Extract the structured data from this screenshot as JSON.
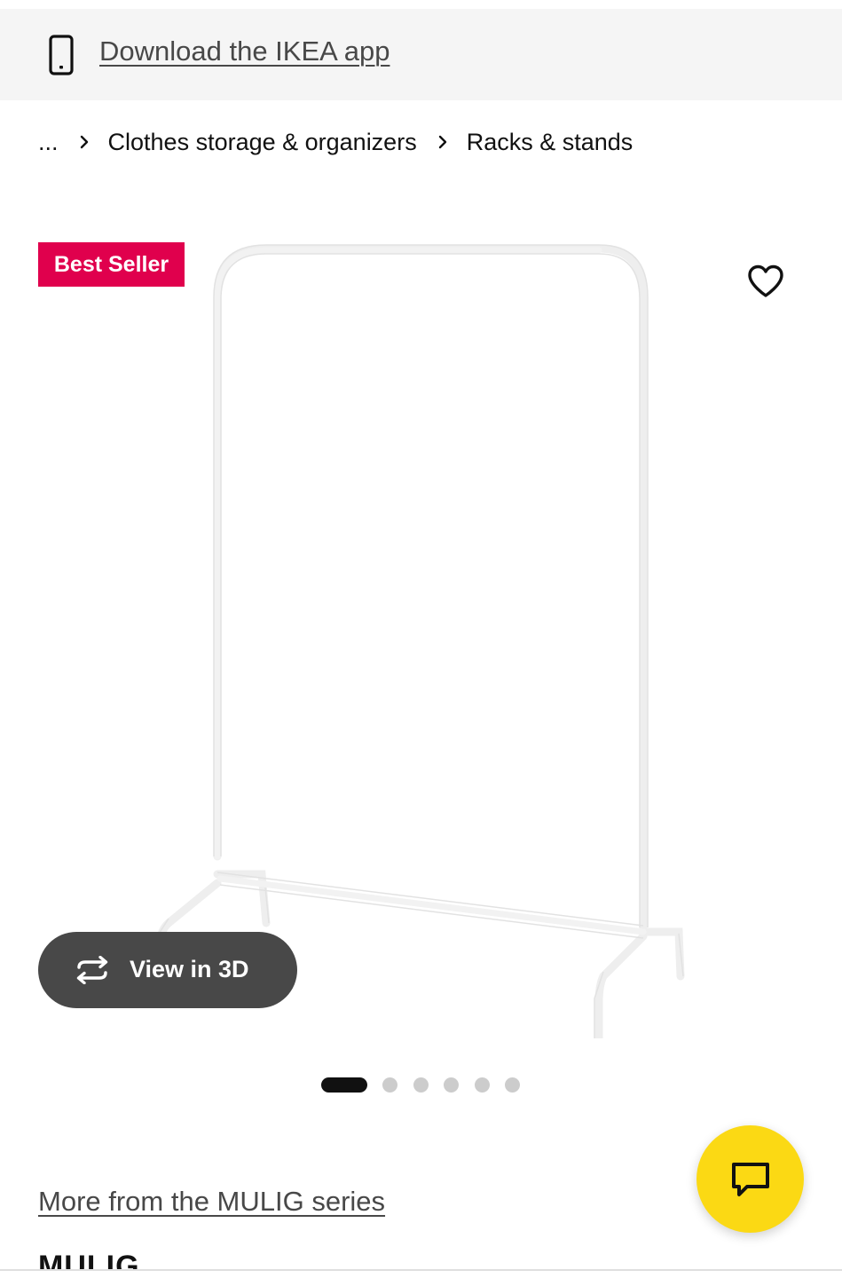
{
  "banner": {
    "text": "Download the IKEA app",
    "icon": "phone-icon"
  },
  "breadcrumb": {
    "items": [
      {
        "label": "..."
      },
      {
        "label": "Clothes storage & organizers"
      },
      {
        "label": "Racks & stands"
      }
    ]
  },
  "product": {
    "badge": "Best Seller",
    "badge_color": "#e0004d",
    "name": "MULIG",
    "image_icon": "clothes-rack-image",
    "favorite_icon": "heart-outline-icon"
  },
  "gallery": {
    "view3d_label": "View in 3D",
    "view3d_icon": "rotate-3d-icon",
    "slide_count": 6,
    "active_slide": 1
  },
  "series": {
    "link_text": "More from the MULIG series"
  },
  "chat": {
    "icon": "chat-bubble-icon",
    "color": "#fbd914"
  }
}
